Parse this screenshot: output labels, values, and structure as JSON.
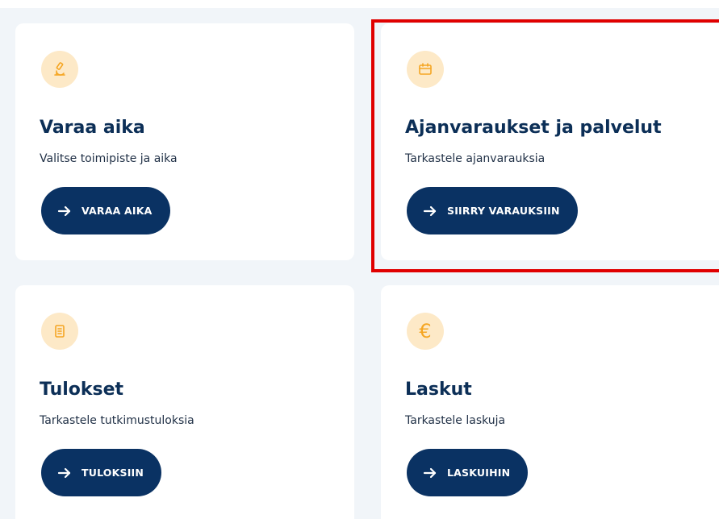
{
  "cards": [
    {
      "icon": "microscope-icon",
      "title": "Varaa aika",
      "description": "Valitse toimipiste ja aika",
      "button_label": "VARAA AIKA"
    },
    {
      "icon": "calendar-icon",
      "title": "Ajanvaraukset ja palvelut",
      "description": "Tarkastele ajanvarauksia",
      "button_label": "SIIRRY VARAUKSIIN"
    },
    {
      "icon": "document-icon",
      "title": "Tulokset",
      "description": "Tarkastele tutkimustuloksia",
      "button_label": "TULOKSIIN"
    },
    {
      "icon": "euro-icon",
      "icon_glyph": "€",
      "title": "Laskut",
      "description": "Tarkastele laskuja",
      "button_label": "LASKUIHIN"
    }
  ],
  "colors": {
    "background": "#f1f5f9",
    "card": "#ffffff",
    "title_text": "#0c2f57",
    "button": "#0a3263",
    "icon_circle": "#fde9c7",
    "icon": "#f5a623",
    "highlight": "#e00000"
  }
}
